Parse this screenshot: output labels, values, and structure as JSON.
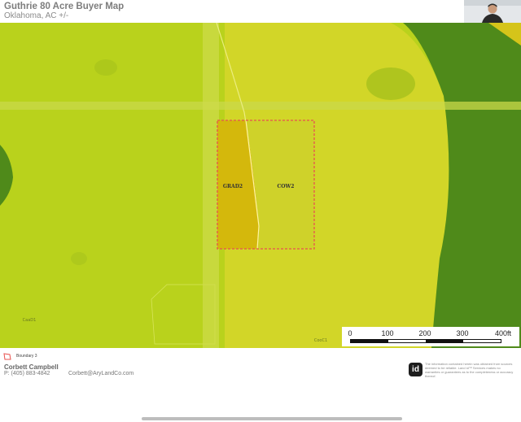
{
  "header": {
    "title": "Guthrie 80 Acre Buyer Map",
    "subtitle": "Oklahoma,  AC +/-"
  },
  "map": {
    "parcel_labels": [
      "GRAD2",
      "COW2"
    ],
    "road_labels": [
      "CaaD1",
      "CooC1"
    ],
    "boundary_color": "#e8524f",
    "soil_colors": {
      "dark_green": "#4f8a1a",
      "lime": "#b9d21c",
      "yellow_green": "#d5d62a",
      "gold": "#d4b80c"
    },
    "scale_bar": {
      "ticks": [
        "0",
        "100",
        "200",
        "300",
        "400ft"
      ]
    }
  },
  "legend": {
    "items": [
      {
        "label": "Boundary 3",
        "color": "#e8524f"
      }
    ]
  },
  "contact": {
    "name": "Corbett Campbell",
    "phone": "P: (405) 883-4842",
    "email": "Corbett@AryLandCo.com"
  },
  "footer": {
    "logo_text": "id",
    "disclaimer": "The information contained herein was obtained from sources deemed to be reliable. Land id™ Services makes no warranties or guarantees as to the completeness or accuracy thereof."
  }
}
